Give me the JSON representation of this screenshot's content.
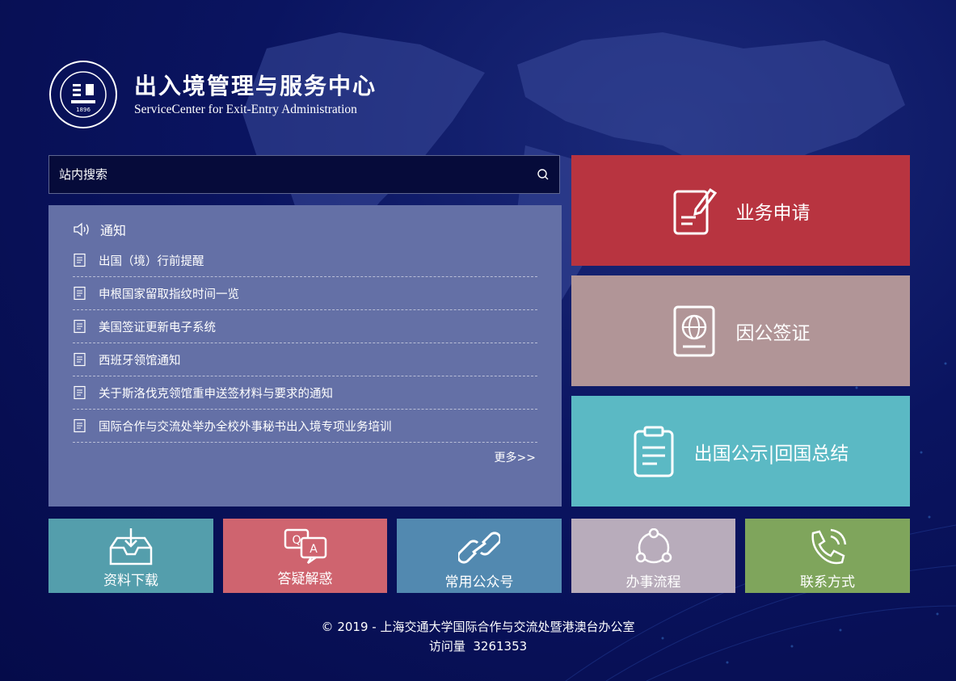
{
  "header": {
    "title_cn": "出入境管理与服务中心",
    "title_en": "ServiceCenter for Exit-Entry Administration",
    "logo_year": "1896"
  },
  "search": {
    "placeholder": "站内搜索"
  },
  "notice": {
    "heading": "通知",
    "items": [
      "出国（境）行前提醒",
      "申根国家留取指纹时间一览",
      "美国签证更新电子系统",
      "西班牙领馆通知",
      "关于斯洛伐克领馆重申送签材料与要求的通知",
      "国际合作与交流处举办全校外事秘书出入境专项业务培训"
    ],
    "more": "更多>>"
  },
  "tiles": {
    "apply": "业务申请",
    "visa": "因公签证",
    "publicity": "出国公示|回国总结"
  },
  "shortcuts": {
    "download": "资料下载",
    "faq": "答疑解惑",
    "wechat": "常用公众号",
    "process": "办事流程",
    "contact": "联系方式"
  },
  "footer": {
    "copyright": "© 2019 - 上海交通大学国际合作与交流处暨港澳台办公室",
    "visits_label": "访问量",
    "visits_count": "3261353"
  },
  "colors": {
    "apply": "#b83440",
    "visa": "#b19597",
    "publicity": "#5bb9c4",
    "download": "#549eac",
    "faq": "#cf646f",
    "wechat": "#5289b0",
    "process": "#b8acbb",
    "contact": "#7fa55c",
    "notice_panel": "#6470a6"
  }
}
